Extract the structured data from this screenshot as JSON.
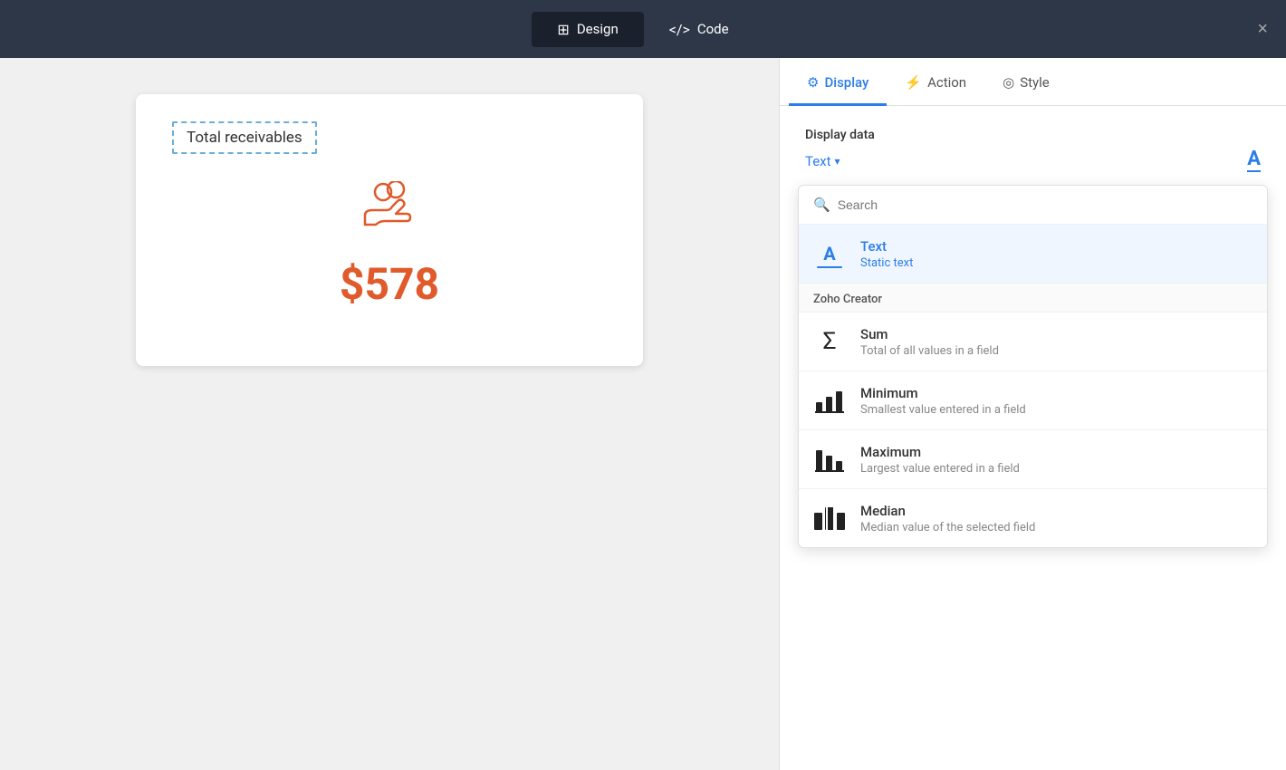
{
  "topbar": {
    "design_label": "Design",
    "code_label": "Code",
    "close_label": "×"
  },
  "panel_tabs": {
    "display_label": "Display",
    "action_label": "Action",
    "style_label": "Style"
  },
  "canvas": {
    "widget_title": "Total receivables",
    "widget_value": "$578"
  },
  "display_panel": {
    "section_label": "Display data",
    "dropdown_label": "Text",
    "search_placeholder": "Search"
  },
  "dropdown_items": {
    "section_text": "Text",
    "text_title": "Text",
    "text_subtitle": "Static text",
    "zoho_creator_section": "Zoho Creator",
    "sum_title": "Sum",
    "sum_subtitle": "Total of all values in a field",
    "minimum_title": "Minimum",
    "minimum_subtitle": "Smallest value entered in a field",
    "maximum_title": "Maximum",
    "maximum_subtitle": "Largest value entered in a field",
    "median_title": "Median",
    "median_subtitle": "Median value of the selected field"
  }
}
